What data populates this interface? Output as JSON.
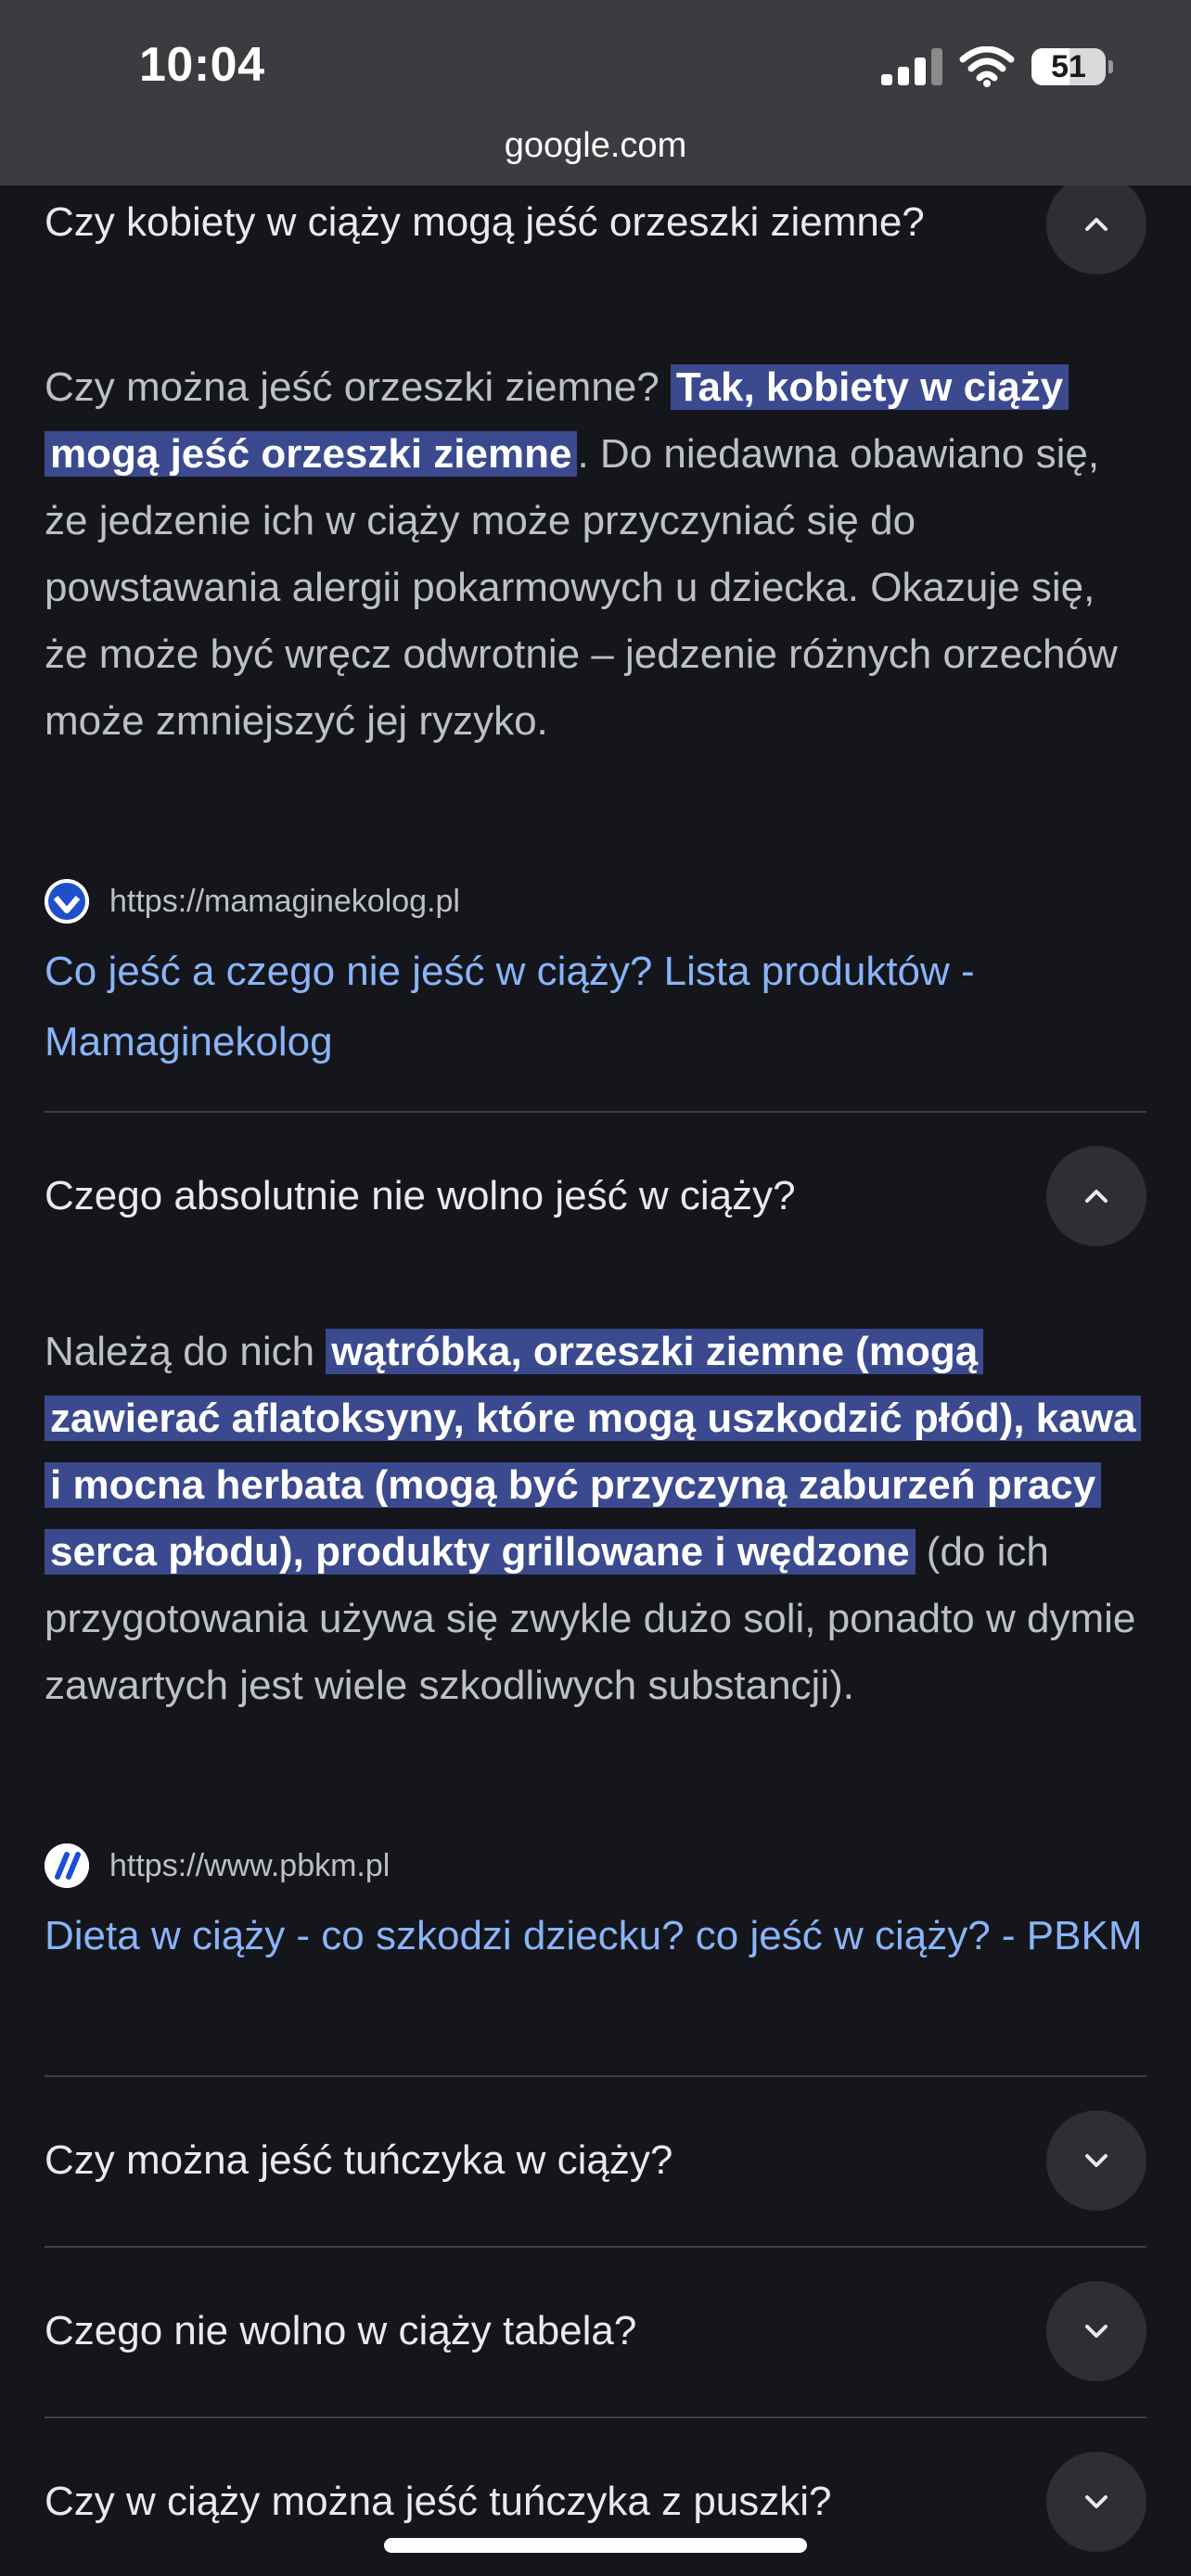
{
  "status_bar": {
    "time": "10:04",
    "battery": "51",
    "battery_level_percent": 51,
    "url": "google.com"
  },
  "faq": [
    {
      "question": "Czy kobiety w ciąży mogą jeść orzeszki ziemne?",
      "expanded": true,
      "answer_pre": "Czy można jeść orzeszki ziemne? ",
      "answer_highlight": "Tak, kobiety w ciąży mogą jeść orzeszki ziemne",
      "answer_post": ". Do niedawna obawiano się, że jedzenie ich w ciąży może przyczyniać się do powstawania alergii pokarmowych u dziecka. Okazuje się, że może być wręcz odwrotnie – jedzenie różnych orzechów może zmniejszyć jej ryzyko.",
      "source_url": "https://mamaginekolog.pl",
      "source_title": "Co jeść a czego nie jeść w ciąży? Lista produktów - Mamaginekolog"
    },
    {
      "question": "Czego absolutnie nie wolno jeść w ciąży?",
      "expanded": true,
      "answer_pre": "Należą do nich ",
      "answer_highlight": "wątróbka, orzeszki ziemne (mogą zawierać aflatoksyny, które mogą uszkodzić płód), kawa i mocna herbata (mogą być przyczyną zaburzeń pracy serca płodu), produkty grillowane i wędzone",
      "answer_post": " (do ich przygotowania używa się zwykle dużo soli, ponadto w dymie zawartych jest wiele szkodliwych substancji).",
      "source_url": "https://www.pbkm.pl",
      "source_title": "Dieta w ciąży - co szkodzi dziecku? co jeść w ciąży? - PBKM"
    },
    {
      "question": "Czy można jeść tuńczyka w ciąży?",
      "expanded": false
    },
    {
      "question": "Czego nie wolno w ciąży tabela?",
      "expanded": false
    },
    {
      "question": "Czy w ciąży można jeść tuńczyka z puszki?",
      "expanded": false
    }
  ],
  "colors": {
    "background": "#15161b",
    "highlight": "#3b4a8e",
    "link": "#8ab4f8",
    "status_bar": "#3a3c40"
  }
}
